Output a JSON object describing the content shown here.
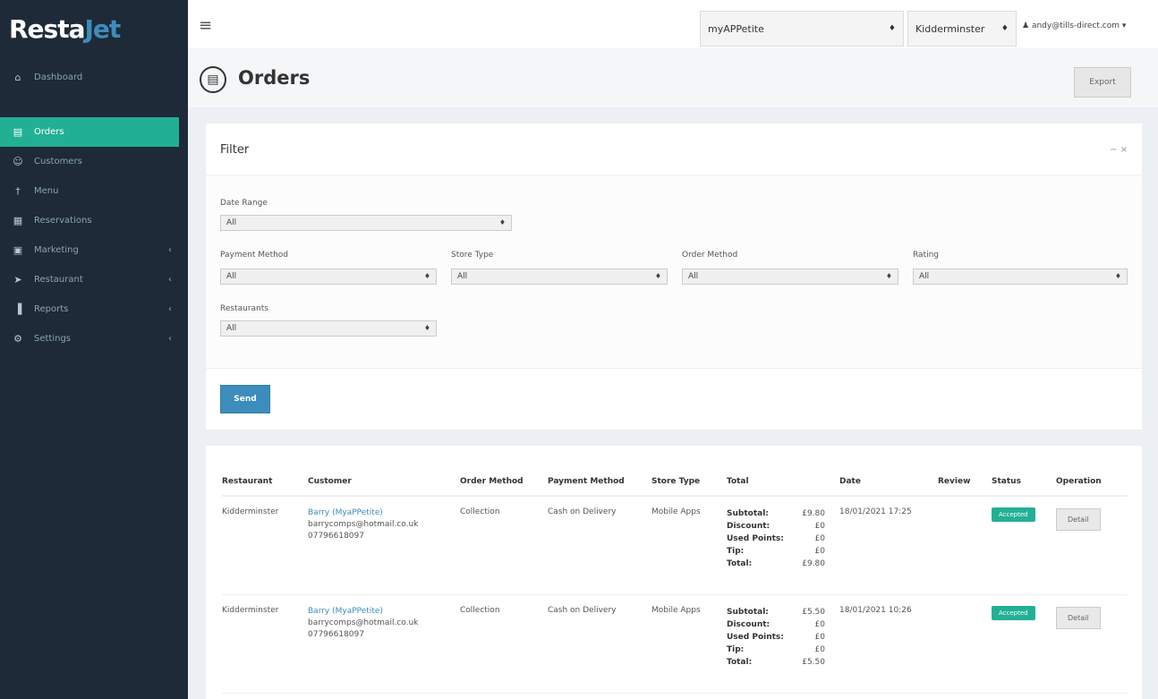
{
  "app": {
    "brand": "Resta",
    "brand_accent": "Jet"
  },
  "sidebar": {
    "items": [
      {
        "label": "Dashboard",
        "icon": "dashboard-icon",
        "glyph": "⌂"
      },
      {
        "label": "Orders",
        "icon": "cart-icon",
        "glyph": "▤",
        "active": true
      },
      {
        "label": "Customers",
        "icon": "users-icon",
        "glyph": "☺"
      },
      {
        "label": "Menu",
        "icon": "cutlery-icon",
        "glyph": "†"
      },
      {
        "label": "Reservations",
        "icon": "calendar-icon",
        "glyph": "▦"
      },
      {
        "label": "Marketing",
        "icon": "marketing-icon",
        "glyph": "▣",
        "caret": "‹"
      },
      {
        "label": "Restaurant",
        "icon": "location-arrow-icon",
        "glyph": "➤",
        "caret": "‹"
      },
      {
        "label": "Reports",
        "icon": "bar-chart-icon",
        "glyph": "▐",
        "caret": "‹"
      },
      {
        "label": "Settings",
        "icon": "gear-icon",
        "glyph": "⚙",
        "caret": "‹"
      }
    ]
  },
  "topbar": {
    "menu_icon": "≡",
    "brand_select": "myAPPetite",
    "location_select": "Kidderminster",
    "select_arrow": "♦",
    "user_icon": "♟",
    "user_email": "andy@tills-direct.com",
    "user_caret": "▾"
  },
  "page": {
    "title": "Orders",
    "title_icon": "▤",
    "export_label": "Export"
  },
  "filter": {
    "title": "Filter",
    "tools": "− ×",
    "date_range": {
      "label": "Date Range",
      "value": "All"
    },
    "payment_method": {
      "label": "Payment Method",
      "value": "All"
    },
    "store_type": {
      "label": "Store Type",
      "value": "All"
    },
    "order_method": {
      "label": "Order Method",
      "value": "All"
    },
    "rating": {
      "label": "Rating",
      "value": "All"
    },
    "restaurants": {
      "label": "Restaurants",
      "value": "All"
    },
    "select_arrow": "♦",
    "send_label": "Send"
  },
  "orders": {
    "columns": [
      "Restaurant",
      "Customer",
      "Order Method",
      "Payment Method",
      "Store Type",
      "Total",
      "Date",
      "Review",
      "Status",
      "Operation"
    ],
    "total_labels": [
      "Subtotal:",
      "Discount:",
      "Used Points:",
      "Tip:",
      "Total:"
    ],
    "rows": [
      {
        "restaurant": "Kidderminster",
        "customer_name": "Barry (MyaPPetite)",
        "customer_email": "barrycomps@hotmail.co.uk",
        "customer_phone": "07796618097",
        "order_method": "Collection",
        "payment_method": "Cash on Delivery",
        "store_type": "Mobile Apps",
        "subtotal": "£9.80",
        "discount": "£0",
        "used_points": "£0",
        "tip": "£0",
        "total": "£9.80",
        "date": "18/01/2021 17:25",
        "review": "",
        "status": "Accepted",
        "operation": "Detail"
      },
      {
        "restaurant": "Kidderminster",
        "customer_name": "Barry (MyaPPetite)",
        "customer_email": "barrycomps@hotmail.co.uk",
        "customer_phone": "07796618097",
        "order_method": "Collection",
        "payment_method": "Cash on Delivery",
        "store_type": "Mobile Apps",
        "subtotal": "£5.50",
        "discount": "£0",
        "used_points": "£0",
        "tip": "£0",
        "total": "£5.50",
        "date": "18/01/2021 10:26",
        "review": "",
        "status": "Accepted",
        "operation": "Detail"
      }
    ]
  },
  "colors": {
    "sidebar_bg": "#1e2a38",
    "active_green": "#22b095",
    "primary_blue": "#3c8dbc",
    "page_bg": "#ecf0f5"
  }
}
